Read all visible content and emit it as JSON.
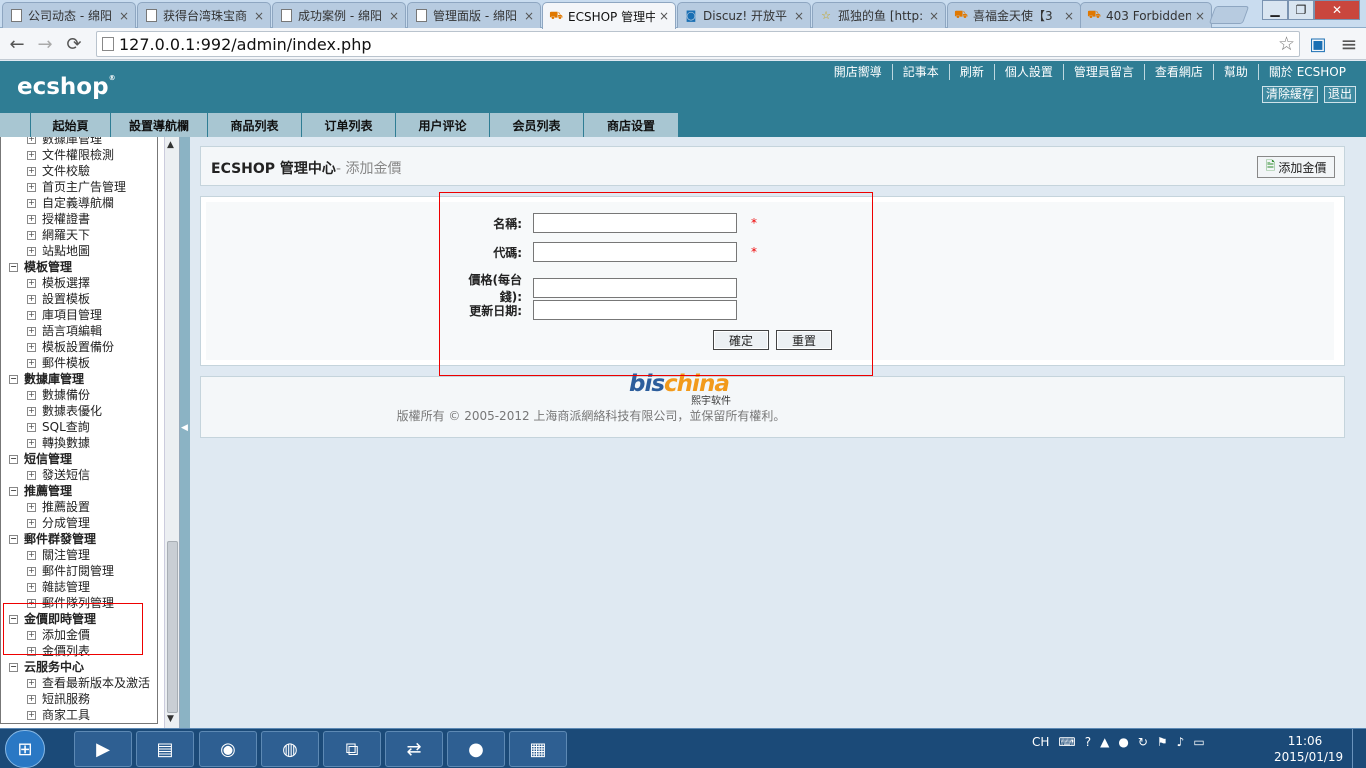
{
  "browser": {
    "tabs": [
      {
        "label": "公司动态 - 绵阳",
        "icon": "doc-icon",
        "active": false
      },
      {
        "label": "获得台湾珠宝商",
        "icon": "doc-icon",
        "active": false
      },
      {
        "label": "成功案例 - 绵阳",
        "icon": "doc-icon",
        "active": false
      },
      {
        "label": "管理面版 - 绵阳",
        "icon": "doc-icon",
        "active": false
      },
      {
        "label": "ECSHOP 管理中",
        "icon": "cart-icon",
        "active": true
      },
      {
        "label": "Discuz! 开放平",
        "icon": "discuz-icon",
        "active": false
      },
      {
        "label": "孤独的鱼 [http:",
        "icon": "star-icon",
        "active": false
      },
      {
        "label": "喜福金天使【3",
        "icon": "cart-icon",
        "active": false
      },
      {
        "label": "403 Forbidden",
        "icon": "cart-icon",
        "active": false
      }
    ],
    "close_glyph": "×",
    "url": "127.0.0.1:992/admin/index.php",
    "icons": {
      "back": "←",
      "forward": "→",
      "reload": "⟳",
      "star": "☆",
      "menu": "≡"
    }
  },
  "header": {
    "logo": "ecshop",
    "logo_mark": "®",
    "links": [
      "開店嚮導",
      "記事本",
      "刷新",
      "個人設置",
      "管理員留言",
      "查看網店",
      "幫助",
      "關於 ECSHOP"
    ],
    "buttons": [
      "清除緩存",
      "退出"
    ]
  },
  "menu": {
    "items": [
      "起始頁",
      "設置導航欄",
      "商品列表",
      "订单列表",
      "用户评论",
      "会员列表",
      "商店设置"
    ]
  },
  "sidebar": {
    "groups": [
      {
        "label": "",
        "items": [
          "數據庫管理",
          "文件權限檢測",
          "文件校驗",
          "首页主广告管理",
          "自定義導航欄",
          "授權證書",
          "網羅天下",
          "站點地圖"
        ]
      },
      {
        "label": "模板管理",
        "items": [
          "模板選擇",
          "設置模板",
          "庫項目管理",
          "語言項編輯",
          "模板設置備份",
          "郵件模板"
        ]
      },
      {
        "label": "數據庫管理",
        "items": [
          "數據備份",
          "數據表優化",
          "SQL查詢",
          "轉換數據"
        ]
      },
      {
        "label": "短信管理",
        "items": [
          "發送短信"
        ]
      },
      {
        "label": "推薦管理",
        "items": [
          "推薦設置",
          "分成管理"
        ]
      },
      {
        "label": "郵件群發管理",
        "items": [
          "關注管理",
          "郵件訂閱管理",
          "雜誌管理",
          "郵件隊列管理"
        ]
      },
      {
        "label": "金價即時管理",
        "items": [
          "添加金價",
          "金價列表"
        ]
      },
      {
        "label": "云服务中心",
        "items": [
          "查看最新版本及激活",
          "短訊服務",
          "商家工具"
        ]
      }
    ],
    "expanded_glyph": "−",
    "item_glyph": "+"
  },
  "main": {
    "title": "ECSHOP 管理中心",
    "subtitle": "- 添加金價",
    "action_button": "添加金價",
    "form": {
      "fields": [
        {
          "label": "名稱:",
          "value": "",
          "required": true
        },
        {
          "label": "代碼:",
          "value": "",
          "required": true
        },
        {
          "label": "價格(每台錢):",
          "value": "",
          "required": false
        },
        {
          "label": "更新日期:",
          "value": "",
          "required": false
        }
      ],
      "required_mark": "*",
      "submit": "確定",
      "reset": "重置"
    },
    "footer": {
      "brand_a": "bis",
      "brand_b": "china",
      "brand_sub": "熙宇软件",
      "copyright": "版權所有 © 2005-2012 上海商派網絡科技有限公司，並保留所有權利。"
    }
  },
  "taskbar": {
    "tray_lang": "CH",
    "time": "11:06",
    "date": "2015/01/19"
  },
  "colors": {
    "header_bg": "#2f7d94",
    "menu_item_bg": "#a8c6d2",
    "required": "#e00000",
    "highlight_box": "#e00000"
  }
}
